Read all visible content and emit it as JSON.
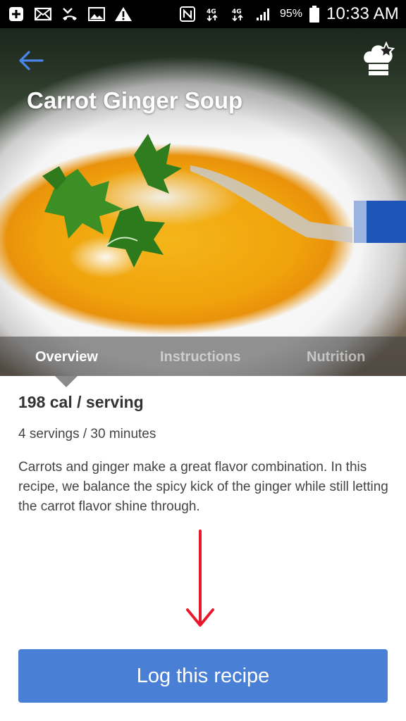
{
  "status_bar": {
    "battery": "95%",
    "time": "10:33 AM",
    "icons": [
      "plus-box-icon",
      "mail-icon",
      "missed-call-icon",
      "image-icon",
      "warning-icon",
      "nfc-icon",
      "data-4g-icon",
      "data-4g-lte-icon",
      "signal-icon",
      "battery-icon"
    ]
  },
  "header": {
    "title": "Carrot Ginger Soup",
    "back_icon": "arrow-left-icon",
    "chef_icon": "chef-hat-star-icon",
    "accent": "#4a86e8"
  },
  "tabs": [
    {
      "label": "Overview",
      "active": true
    },
    {
      "label": "Instructions",
      "active": false
    },
    {
      "label": "Nutrition",
      "active": false
    }
  ],
  "overview": {
    "calories": "198 cal / serving",
    "servings": "4 servings / 30 minutes",
    "description": "Carrots and ginger make a great flavor combination. In this recipe, we balance the spicy kick of the ginger while still letting the carrot flavor shine through."
  },
  "annotation": {
    "arrow_color": "#e8192c"
  },
  "action": {
    "log_label": "Log this recipe",
    "button_color": "#4a7fd6"
  }
}
